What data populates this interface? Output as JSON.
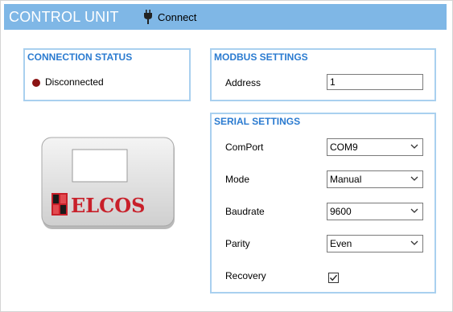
{
  "header": {
    "title": "CONTROL UNIT",
    "connect_label": "Connect"
  },
  "connection_status": {
    "title": "CONNECTION STATUS",
    "status_text": "Disconnected",
    "status_color": "#8b1414"
  },
  "modbus": {
    "title": "MODBUS SETTINGS",
    "address_label": "Address",
    "address_value": "1"
  },
  "serial": {
    "title": "SERIAL SETTINGS",
    "comport_label": "ComPort",
    "comport_value": "COM9",
    "mode_label": "Mode",
    "mode_value": "Manual",
    "baudrate_label": "Baudrate",
    "baudrate_value": "9600",
    "parity_label": "Parity",
    "parity_value": "Even",
    "recovery_label": "Recovery",
    "recovery_checked": true
  },
  "device_image": {
    "brand": "ELCOS",
    "brand_color": "#c8202a",
    "accent_color": "#7fb7e6"
  }
}
